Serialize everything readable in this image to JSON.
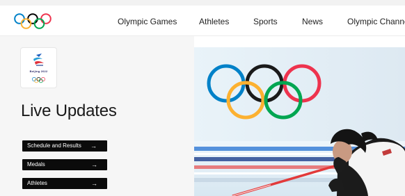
{
  "header": {
    "logo_icon": "olympic-rings-icon",
    "nav": [
      {
        "label": "Olympic Games"
      },
      {
        "label": "Athletes"
      },
      {
        "label": "Sports"
      },
      {
        "label": "News"
      },
      {
        "label": "Olympic Channe"
      }
    ]
  },
  "sidebar": {
    "emblem_icon": "beijing-2022-emblem-icon",
    "emblem_text": "Beijing 2022",
    "title": "Live Updates",
    "buttons": [
      {
        "label": "Schedule and Results",
        "arrow": "→"
      },
      {
        "label": "Medals",
        "arrow": "→"
      },
      {
        "label": "Athletes",
        "arrow": "→"
      }
    ]
  },
  "hero": {
    "image": "curling-athlete-photo",
    "icon": "olympic-rings-icon"
  },
  "colors": {
    "ring_blue": "#0081c8",
    "ring_yellow": "#fcb131",
    "ring_black": "#000000",
    "ring_green": "#00a651",
    "ring_red": "#ee334e",
    "button_bg": "#0b0b0b",
    "panel_bg": "#f6f6f6"
  }
}
